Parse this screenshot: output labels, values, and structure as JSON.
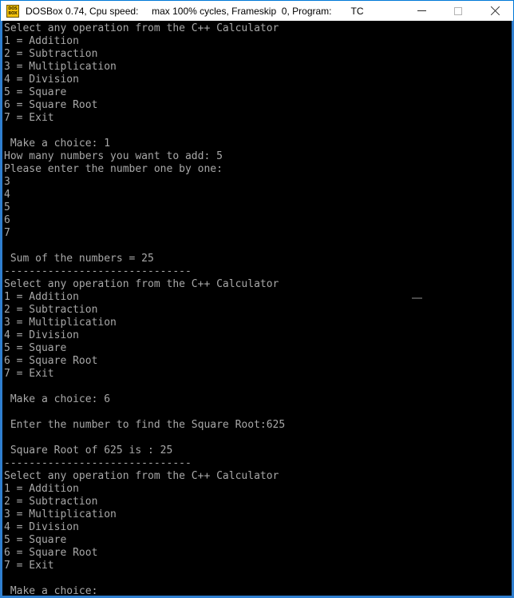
{
  "window": {
    "icon_name": "dosbox-icon",
    "icon_line1": "DOS",
    "icon_line2": "BOX",
    "title": "DOSBox 0.74, Cpu speed:     max 100% cycles, Frameskip  0, Program:",
    "program": "TC",
    "buttons": {
      "minimize": "minimize",
      "maximize": "maximize",
      "close": "close"
    },
    "border_color": "#2f7fd0",
    "titlebar_bg": "#ffffff"
  },
  "console": {
    "background": "#000000",
    "foreground": "#a8a8a8",
    "lines": [
      "Select any operation from the C++ Calculator",
      "1 = Addition",
      "2 = Subtraction",
      "3 = Multiplication",
      "4 = Division",
      "5 = Square",
      "6 = Square Root",
      "7 = Exit",
      "",
      " Make a choice: 1",
      "How many numbers you want to add: 5",
      "Please enter the number one by one:",
      "3",
      "4",
      "5",
      "6",
      "7",
      "",
      " Sum of the numbers = 25",
      "------------------------------",
      "Select any operation from the C++ Calculator",
      "1 = Addition",
      "2 = Subtraction",
      "3 = Multiplication",
      "4 = Division",
      "5 = Square",
      "6 = Square Root",
      "7 = Exit",
      "",
      " Make a choice: 6",
      "",
      " Enter the number to find the Square Root:625",
      "",
      " Square Root of 625 is : 25",
      "------------------------------",
      "Select any operation from the C++ Calculator",
      "1 = Addition",
      "2 = Subtraction",
      "3 = Multiplication",
      "4 = Division",
      "5 = Square",
      "6 = Square Root",
      "7 = Exit",
      "",
      " Make a choice:"
    ]
  }
}
